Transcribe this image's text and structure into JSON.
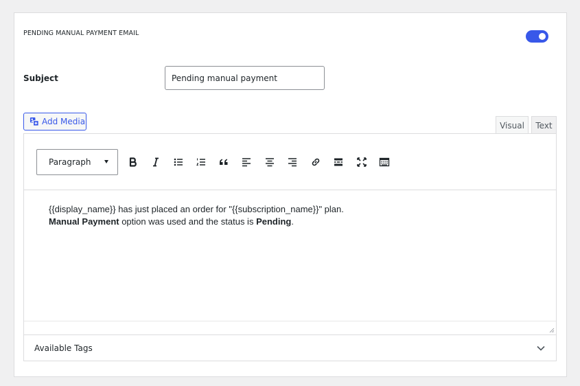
{
  "section": {
    "title": "PENDING MANUAL PAYMENT EMAIL",
    "toggle_on": true
  },
  "subject": {
    "label": "Subject",
    "value": "Pending manual payment"
  },
  "media": {
    "add_media_label": "Add Media",
    "icon": "add-media-icon"
  },
  "editor_tabs": {
    "visual": "Visual",
    "text": "Text"
  },
  "toolbar": {
    "format_value": "Paragraph",
    "buttons": [
      "bold-icon",
      "italic-icon",
      "bullet-list-icon",
      "numbered-list-icon",
      "blockquote-icon",
      "align-left-icon",
      "align-center-icon",
      "align-right-icon",
      "link-icon",
      "read-more-icon",
      "fullscreen-icon",
      "toolbar-toggle-icon"
    ]
  },
  "content": {
    "line1": "{{display_name}} has just placed an order for \"{{subscription_name}}\" plan.",
    "line2_bold1": "Manual Payment",
    "line2_mid": " option was used and the status is ",
    "line2_bold2": "Pending",
    "line2_end": "."
  },
  "available_tags": {
    "label": "Available Tags"
  },
  "colors": {
    "accent": "#3858e9",
    "border": "#dcdcde",
    "background": "#f0f0f1"
  }
}
